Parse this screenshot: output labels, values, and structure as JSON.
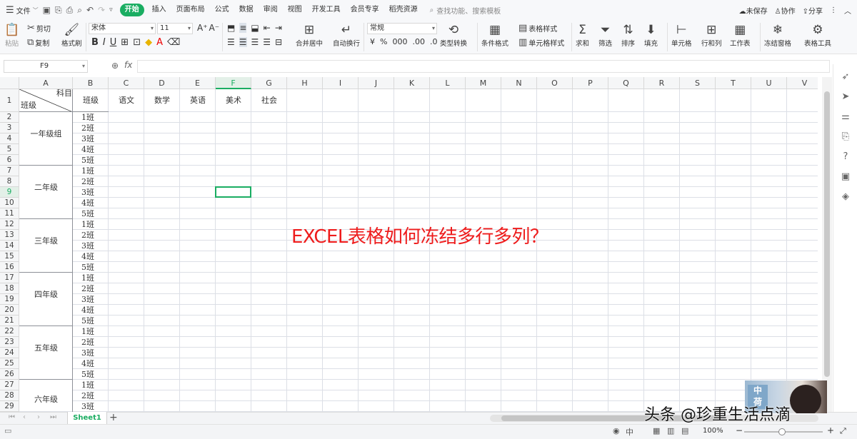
{
  "menubar": {
    "file_label": "文件",
    "tabs": [
      "开始",
      "插入",
      "页面布局",
      "公式",
      "数据",
      "审阅",
      "视图",
      "开发工具",
      "会员专享",
      "稻壳资源"
    ],
    "active_tab": "开始",
    "search_placeholder": "查找功能、搜索模板",
    "unsaved": "未保存",
    "collab": "协作",
    "share": "分享"
  },
  "ribbon": {
    "paste": "粘贴",
    "cut": "剪切",
    "copy": "复制",
    "format_painter": "格式刷",
    "font_name": "宋体",
    "font_size": "11",
    "number_format": "常规",
    "merge_center": "合并居中",
    "auto_wrap": "自动换行",
    "type_convert": "类型转换",
    "cond_format": "条件格式",
    "table_style": "表格样式",
    "cell_style": "单元格样式",
    "sum": "求和",
    "filter": "筛选",
    "sort": "排序",
    "fill": "填充",
    "cell": "单元格",
    "rowcol": "行和列",
    "worksheet": "工作表",
    "freeze": "冻结窗格",
    "table_tools": "表格工具"
  },
  "formula_bar": {
    "cell_ref": "F9",
    "fx": "fx",
    "formula": ""
  },
  "grid": {
    "columns": [
      "A",
      "B",
      "C",
      "D",
      "E",
      "F",
      "G",
      "H",
      "I",
      "J",
      "K",
      "L",
      "M",
      "N",
      "O",
      "P",
      "Q",
      "R",
      "S",
      "T",
      "U",
      "V"
    ],
    "rows": [
      "1",
      "2",
      "3",
      "4",
      "5",
      "6",
      "7",
      "8",
      "9",
      "10",
      "11",
      "12",
      "13",
      "14",
      "15",
      "16",
      "17",
      "18",
      "19",
      "20",
      "21",
      "22",
      "23",
      "24",
      "25",
      "26",
      "27",
      "28",
      "29"
    ],
    "selected_col": "F",
    "selected_row": "9",
    "header_row": {
      "a_top": "科目",
      "a_bottom": "班级",
      "b": "班级",
      "c": "语文",
      "d": "数学",
      "e": "英语",
      "f": "美术",
      "g": "社会"
    },
    "grades": [
      "一年级组",
      "二年级",
      "三年级",
      "四年级",
      "五年级",
      "六年级"
    ],
    "classes": [
      "1班",
      "2班",
      "3班",
      "4班",
      "5班"
    ]
  },
  "overlay_title": "EXCEL表格如何冻结多行多列？",
  "sheet_tabs": [
    "Sheet1"
  ],
  "status": {
    "zoom": "100%"
  },
  "watermark": "头条 @珍重生活点滴",
  "colors": {
    "accent": "#1aad62",
    "overlay": "#ee1c1c"
  }
}
